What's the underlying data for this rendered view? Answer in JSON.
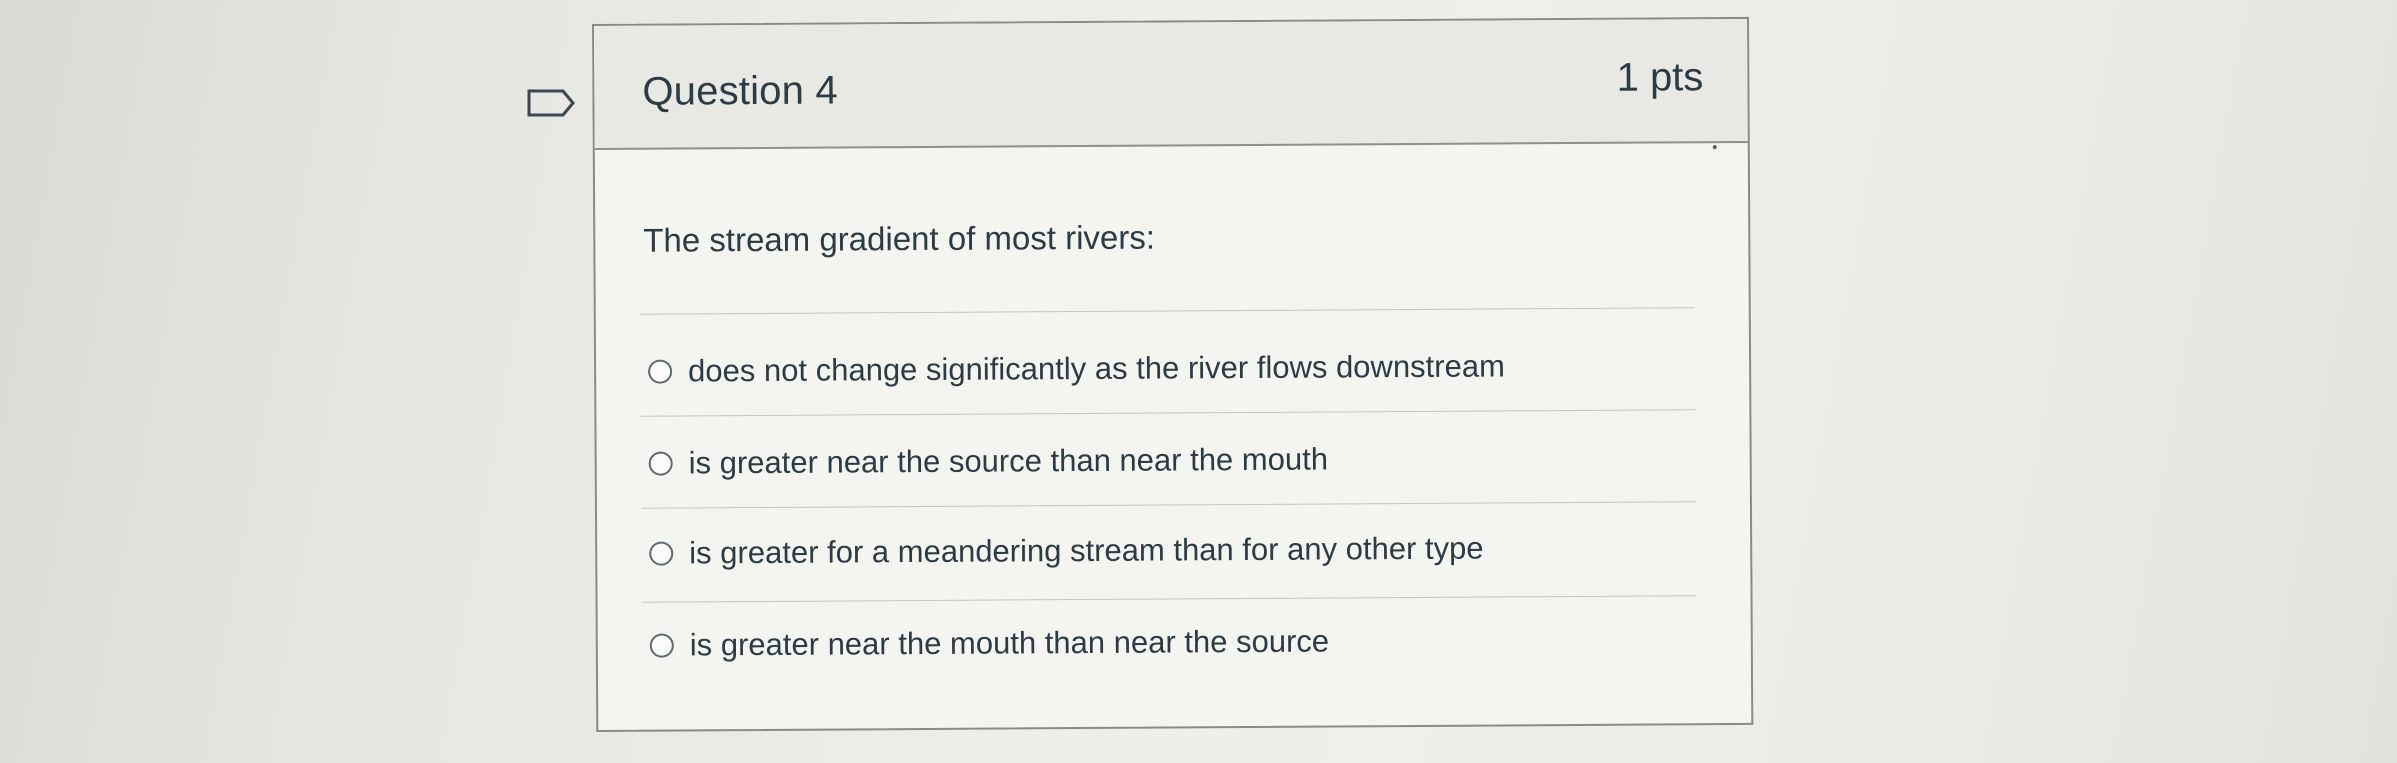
{
  "question": {
    "title": "Question 4",
    "points": "1 pts",
    "text": "The stream gradient of most rivers:",
    "answers": [
      {
        "label": "does not change significantly as the river flows downstream",
        "selected": false
      },
      {
        "label": "is greater near the source than near the mouth",
        "selected": false
      },
      {
        "label": "is greater for a meandering stream than for any other type",
        "selected": false
      },
      {
        "label": "is greater near the mouth than near the source",
        "selected": false
      }
    ]
  },
  "icons": {
    "flag": "flag-question-icon",
    "radio": "radio-unchecked-icon"
  },
  "colors": {
    "text": "#2d3b45",
    "border": "#8a8a8a",
    "header_bg": "#e8e8e4",
    "card_bg": "#f4f4f1"
  }
}
